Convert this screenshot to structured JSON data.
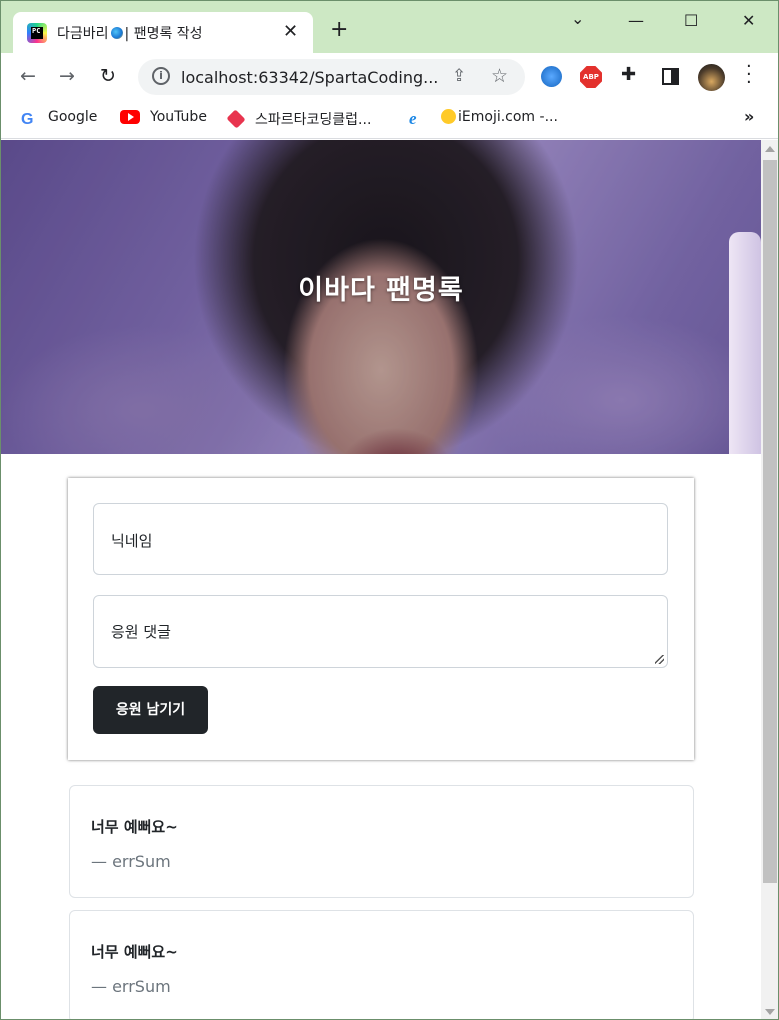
{
  "browser": {
    "tab": {
      "title_prefix": "다금바리",
      "title_suffix": "| 팬명록 작성",
      "favicon_text": "PC",
      "close": "✕"
    },
    "new_tab": "+",
    "window_controls": {
      "minimize": "—",
      "maximize": "☐",
      "close": "✕",
      "dropdown": "⌄"
    },
    "url": "localhost:63342/SpartaCoding...",
    "bookmarks": [
      {
        "label": "Google",
        "icon": "google-icon"
      },
      {
        "label": "YouTube",
        "icon": "youtube-icon"
      },
      {
        "label": "스파르타코딩클럽...",
        "icon": "sparta-icon"
      },
      {
        "label": "iEmoji.com -...",
        "icon": "emoji-icon"
      }
    ],
    "bookmarks_more": "»",
    "extension_abp": "ABP"
  },
  "page": {
    "hero_title": "이바다 팬명록",
    "form": {
      "nickname_placeholder": "닉네임",
      "comment_placeholder": "응원 댓글",
      "submit_label": "응원 남기기"
    },
    "comments": [
      {
        "text": "너무 예뻐요~",
        "author": "— errSum"
      },
      {
        "text": "너무 예뻐요~",
        "author": "— errSum"
      }
    ]
  },
  "colors": {
    "titlebar": "#cde8c4",
    "button_dark": "#212529",
    "muted_text": "#6c757d"
  }
}
